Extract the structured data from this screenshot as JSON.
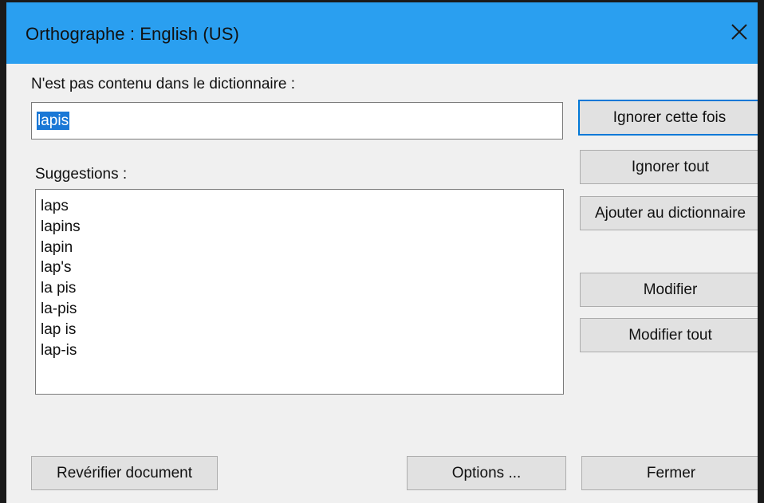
{
  "window": {
    "title": "Orthographe : English (US)"
  },
  "labels": {
    "not_in_dictionary": "N'est pas contenu dans le dictionnaire :",
    "suggestions": "Suggestions :"
  },
  "word_field": {
    "value": "lapis"
  },
  "suggestions": [
    "laps",
    "lapins",
    "lapin",
    "lap's",
    "la pis",
    "la-pis",
    "lap is",
    "lap-is"
  ],
  "buttons": {
    "ignore_once": "Ignorer cette fois",
    "ignore_all": "Ignorer tout",
    "add_to_dictionary": "Ajouter au dictionnaire",
    "change": "Modifier",
    "change_all": "Modifier tout",
    "recheck_document": "Revérifier document",
    "options": "Options ...",
    "close": "Fermer"
  },
  "colors": {
    "titlebar": "#2a9ff0",
    "selection": "#1a78d6",
    "default_button_border": "#0078d7"
  }
}
